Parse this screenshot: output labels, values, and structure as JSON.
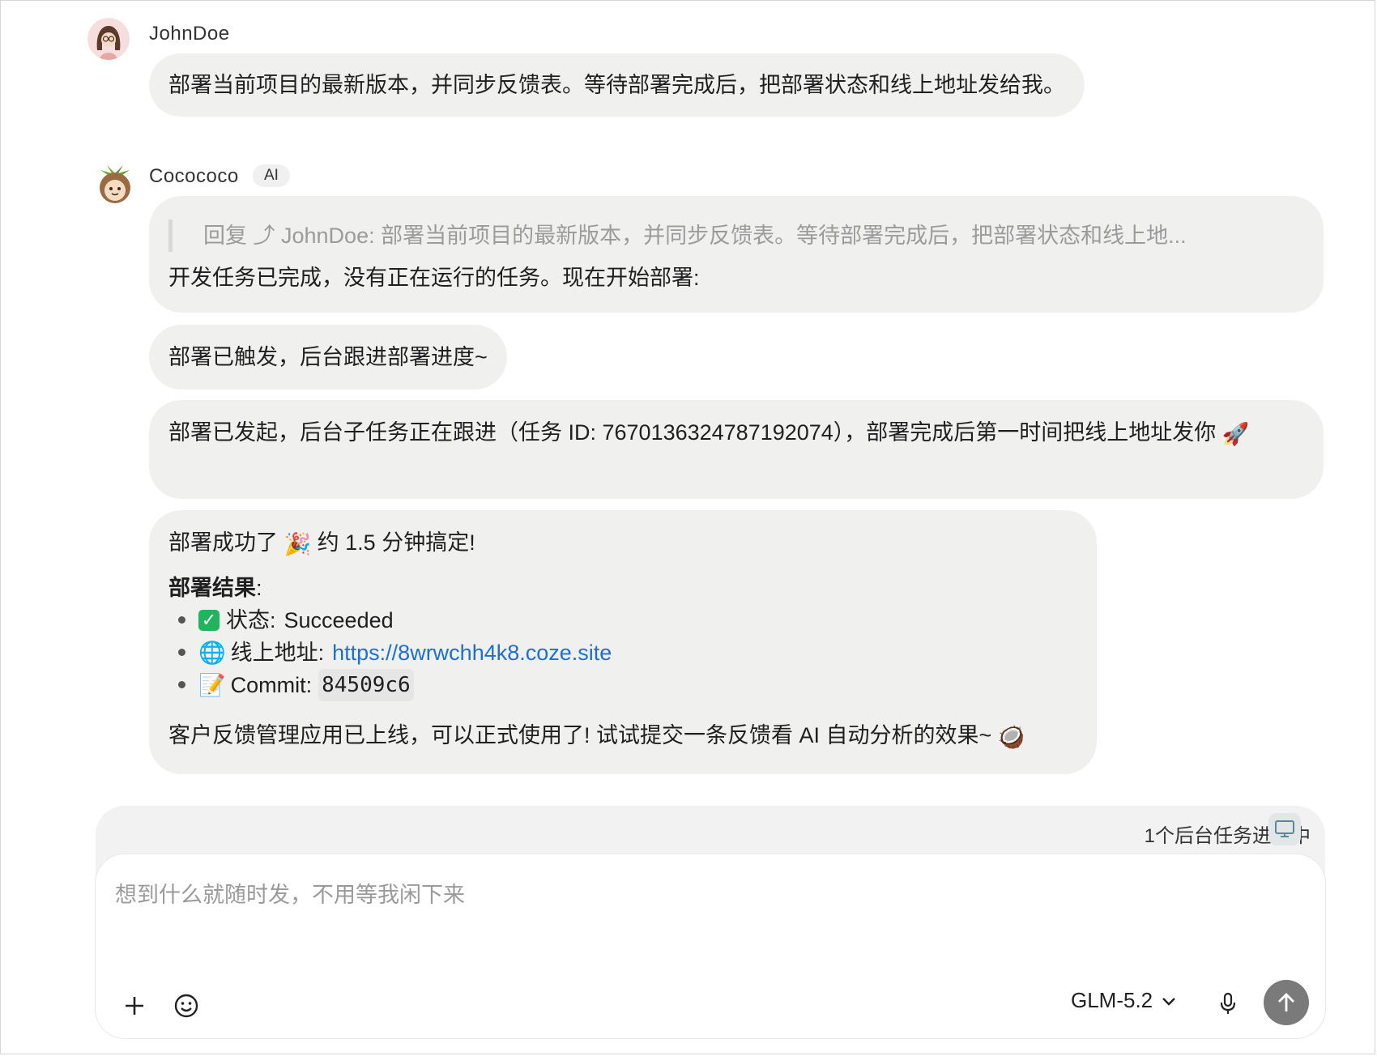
{
  "user_message": {
    "sender": "JohnDoe",
    "text": "部署当前项目的最新版本，并同步反馈表。等待部署完成后，把部署状态和线上地址发给我。"
  },
  "ai": {
    "sender": "Cocococo",
    "badge": "AI",
    "reply_quote": "回复 ⤴ JohnDoe:  部署当前项目的最新版本，并同步反馈表。等待部署完成后，把部署状态和线上地...",
    "message_1": "开发任务已完成，没有正在运行的任务。现在开始部署:",
    "message_2": "部署已触发，后台跟进部署进度~",
    "message_3": "部署已发起，后台子任务正在跟进（任务 ID: 7670136324787192074），部署完成后第一时间把线上地址发你",
    "message_3_emoji": "🚀",
    "result": {
      "headline_a": "部署成功了",
      "headline_emoji": "🎉",
      "headline_b": "约 1.5 分钟搞定!",
      "section_title": "部署结果",
      "section_colon": ":",
      "status_label": "状态:",
      "status_value": "Succeeded",
      "url_emoji": "🌐",
      "url_label": "线上地址:",
      "url_value": "https://8wrwchh4k8.coze.site",
      "commit_emoji": "📝",
      "commit_label": "Commit:",
      "commit_value": "84509c6",
      "footer": "客户反馈管理应用已上线，可以正式使用了! 试试提交一条反馈看 AI 自动分析的效果~",
      "footer_emoji": "🥥"
    }
  },
  "composer": {
    "background_tasks": "1个后台任务进行中",
    "placeholder": "想到什么就随时发，不用等我闲下来",
    "model": "GLM-5.2"
  },
  "icons": [
    "add-icon",
    "emoji-icon",
    "chevron-down-icon",
    "microphone-icon",
    "send-arrow-icon",
    "monitor-icon"
  ],
  "colors": {
    "bubble": "#f0f1ef",
    "link": "#1f6fd1",
    "send_button": "#7a7a7a"
  }
}
